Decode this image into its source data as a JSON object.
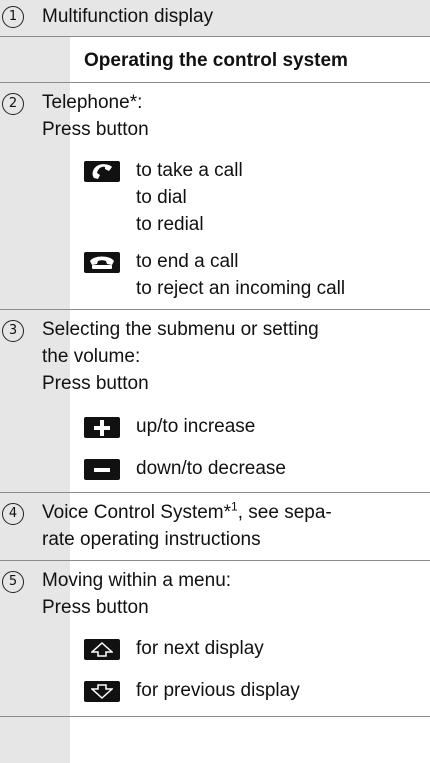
{
  "rows": [
    {
      "num": "1",
      "text": "Multifunction display"
    },
    {
      "heading": "Operating the control system"
    },
    {
      "num": "2",
      "lines": [
        "Telephone*:",
        "Press button"
      ],
      "buttons": [
        {
          "icon": "phone-accept-icon",
          "lines": [
            "to take a call",
            "to dial",
            "to redial"
          ]
        },
        {
          "icon": "phone-end-icon",
          "lines": [
            "to end a call",
            "to reject an incoming call"
          ]
        }
      ]
    },
    {
      "num": "3",
      "lines": [
        "Selecting the submenu or setting",
        "the volume:",
        "Press button"
      ],
      "buttons": [
        {
          "icon": "plus-icon",
          "lines": [
            "up/to increase"
          ]
        },
        {
          "icon": "minus-icon",
          "lines": [
            "down/to decrease"
          ]
        }
      ]
    },
    {
      "num": "4",
      "line1_main": "Voice Control System*",
      "line1_sup": "1",
      "line1_tail": ", see sepa-",
      "line2": "rate operating instructions"
    },
    {
      "num": "5",
      "lines": [
        "Moving within a menu:",
        "Press button"
      ],
      "buttons": [
        {
          "icon": "arrow-up-icon",
          "lines": [
            "for next display"
          ]
        },
        {
          "icon": "arrow-down-icon",
          "lines": [
            "for previous display"
          ]
        }
      ]
    }
  ]
}
